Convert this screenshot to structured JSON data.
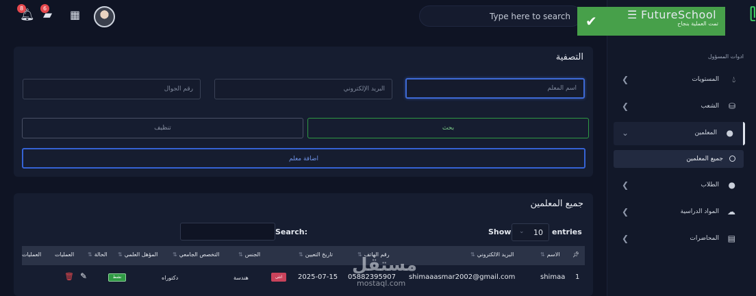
{
  "header": {
    "notifications_count": "8",
    "messages_count": "6",
    "search_placeholder": "Type here to search"
  },
  "toast": {
    "text": "تمت العملية بنجاح"
  },
  "brand": {
    "name": "FutureSchool"
  },
  "sidebar": {
    "section_label": "ادوات المسؤول",
    "items": [
      {
        "label": "المستويات",
        "icon": "drop-icon"
      },
      {
        "label": "الشعب",
        "icon": "basket-icon"
      },
      {
        "label": "المعلمين",
        "icon": "award-icon",
        "expanded": true
      },
      {
        "label": "الطلاب",
        "icon": "award-icon"
      },
      {
        "label": "المواد الدراسية",
        "icon": "cloud-icon"
      },
      {
        "label": "المحاضرات",
        "icon": "document-icon"
      }
    ],
    "sub_item": "جميع المعلمين"
  },
  "filter": {
    "title": "التصفية",
    "teacher_name_placeholder": "اسم المعلم",
    "email_placeholder": "البريد الإلكتروني",
    "phone_placeholder": "رقم الجوال",
    "search_button": "بحث",
    "clear_button": "تنظيف",
    "add_button": "اضافة معلم"
  },
  "table": {
    "title": "جميع المعلمين",
    "show_label": "Show",
    "entries_label": "entries",
    "page_size": "10",
    "search_label": "Search:",
    "columns": [
      "الاسم",
      "البريد الالكتروني",
      "رقم الهاتف",
      "تاريخ التعيين",
      "الجنس",
      "التخصص الجامعي",
      "المؤهل العلمي",
      "الحالة",
      "العمليات",
      "العمليات"
    ],
    "rows": [
      {
        "index": "1",
        "name": "shimaa",
        "email": "shimaaasmar2002@gmail.com",
        "phone": "05882395907",
        "hire_date": "2025-07-15",
        "gender": "انثى",
        "specialization": "هندسة",
        "qualification": "دكتوراه",
        "status": "نشط"
      }
    ]
  },
  "watermark": {
    "arabic": "مستقل",
    "latin": "mostaql.com"
  }
}
